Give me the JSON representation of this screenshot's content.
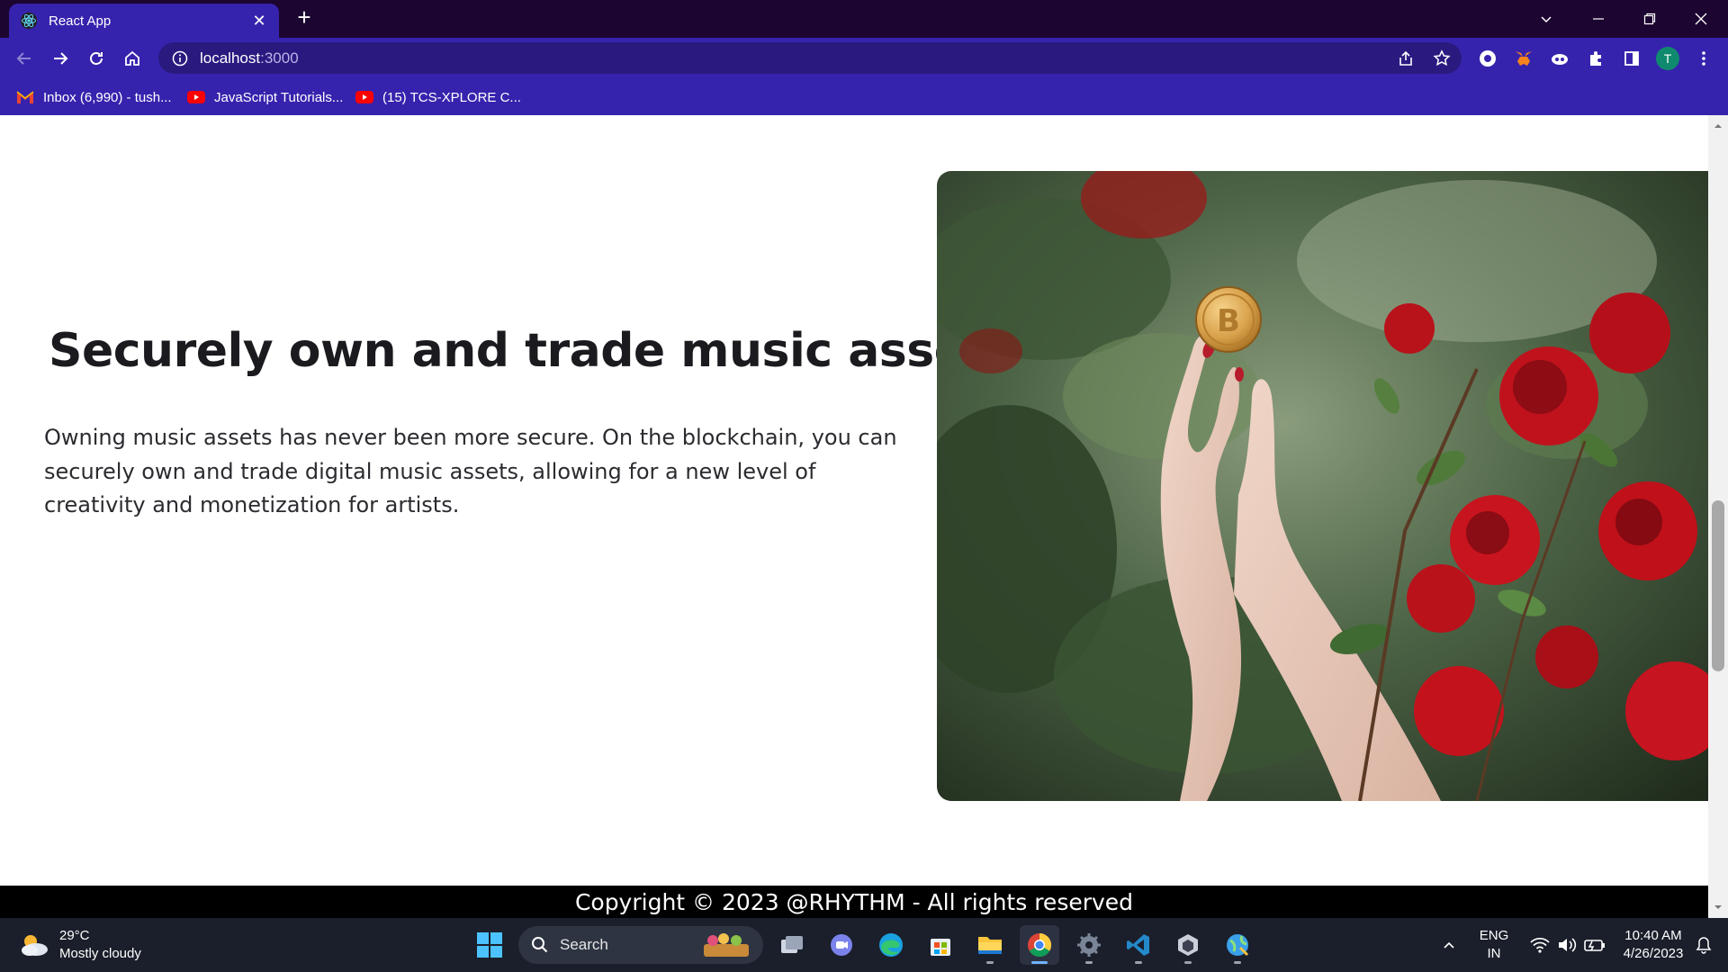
{
  "browser": {
    "tab": {
      "title": "React App"
    },
    "address": {
      "host": "localhost",
      "port": ":3000"
    },
    "profile_initial": "T",
    "bookmarks": [
      {
        "label": "Inbox (6,990) - tush...",
        "icon": "gmail-icon"
      },
      {
        "label": "JavaScript Tutorials...",
        "icon": "youtube-icon"
      },
      {
        "label": "(15) TCS-XPLORE C...",
        "icon": "youtube-icon"
      }
    ]
  },
  "page": {
    "heading": "Securely own and trade music assets.",
    "paragraph": "Owning music assets has never been more secure. On the blockchain, you can securely own and trade digital music assets, allowing for a new level of creativity and monetization for artists.",
    "footer": "Copyright © 2023 @RHYTHM - All rights reserved"
  },
  "taskbar": {
    "weather": {
      "temp": "29°C",
      "condition": "Mostly cloudy"
    },
    "search_label": "Search",
    "language": {
      "line1": "ENG",
      "line2": "IN"
    },
    "clock": {
      "time": "10:40 AM",
      "date": "4/26/2023"
    }
  },
  "colors": {
    "tabstrip": "#1c0530",
    "toolbar": "#3623ad",
    "taskbar": "#1a1f2b",
    "footer": "#000000"
  }
}
